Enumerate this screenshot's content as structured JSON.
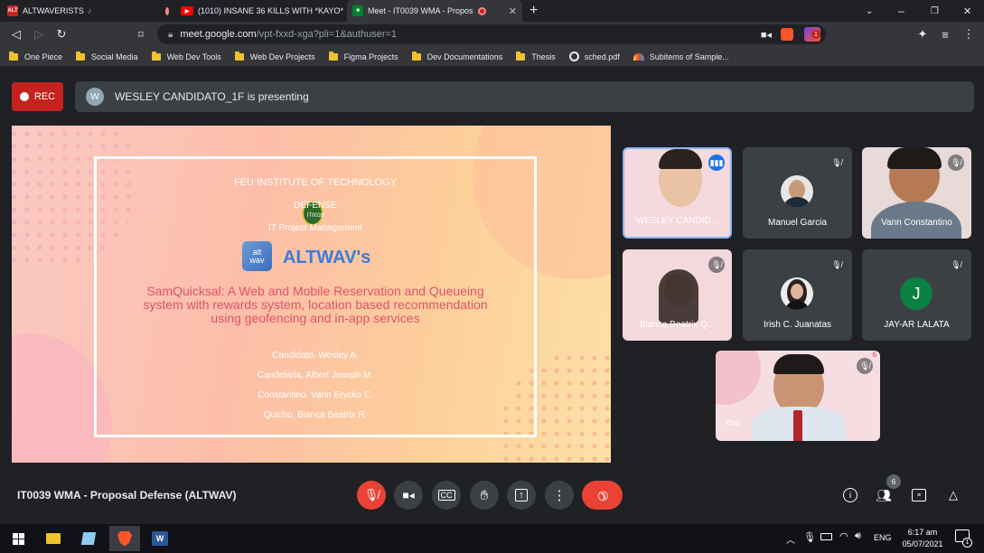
{
  "browser": {
    "tabs": [
      {
        "title": "ALTWAVERISTS",
        "active": false
      },
      {
        "title": "(1010) INSANE 36 KILLS WITH *KAYO*",
        "active": false
      },
      {
        "title": "Meet - IT0039 WMA - Propos",
        "active": true
      }
    ],
    "url_host": "meet.google.com",
    "url_path": "/vpt-fxxd-xga?pli=1&authuser=1",
    "shield_badge": "1",
    "bookmarks": [
      "One Piece",
      "Social Media",
      "Web Dev Tools",
      "Web Dev Projects",
      "Figma Projects",
      "Dev Documentations",
      "Thesis",
      "sched.pdf",
      "Subitems of Sample..."
    ]
  },
  "meet": {
    "rec_label": "REC",
    "presenter_initial": "W",
    "presenting_text": "WESLEY CANDIDATO_1F is presenting",
    "meeting_name": "IT0039 WMA - Proposal Defense (ALTWAV)",
    "people_count": "6",
    "self_badge": "6"
  },
  "slide": {
    "institute": "FEU INSTITUTE OF TECHNOLOGY",
    "defense": "DEFENSE",
    "course_code": "IT0039",
    "course": "IT Project Management",
    "app_icon_top": "alt",
    "app_icon_bottom": "wav",
    "brand": "ALTWAV's",
    "title": "SamQuicksal: A Web and Mobile Reservation and Queueing system with rewards system, location based recommendation using geofencing and in-app services",
    "authors": [
      "Candidato, Wesley A.",
      "Candelaria, Albert Joseph M.",
      "Constantino, Vann Erycko C.",
      "Quicho, Bianca Beatrix R."
    ]
  },
  "participants": [
    {
      "name": "WESLEY CANDID...",
      "speaking": true
    },
    {
      "name": "Manuel Garcia"
    },
    {
      "name": "Vann Constantino"
    },
    {
      "name": "Bianca Beatrix Q..."
    },
    {
      "name": "Irish C. Juanatas"
    },
    {
      "name": "JAY-AR LALATA",
      "initial": "J"
    },
    {
      "name": "You"
    }
  ],
  "taskbar": {
    "language": "ENG",
    "time": "6:17 am",
    "date": "05/07/2021",
    "notification_count": "1"
  },
  "colors": {
    "accent_red": "#ea4335",
    "rec_red": "#c5221f",
    "speaking_blue": "#8ab4f8",
    "slide_title": "#e0526a",
    "brand_blue": "#3c7bd8"
  }
}
